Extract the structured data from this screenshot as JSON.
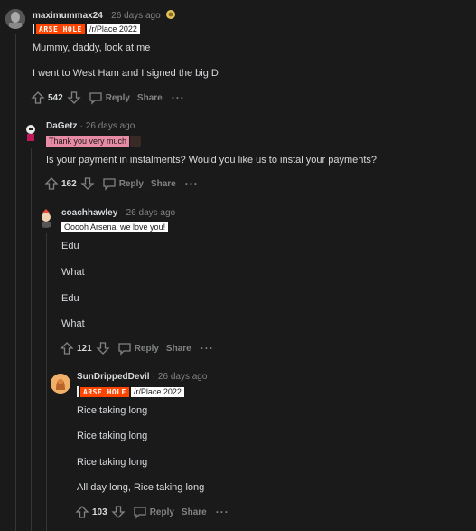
{
  "comments": [
    {
      "author": "maximummax24",
      "time": "26 days ago",
      "award": "award-icon",
      "flair": {
        "logo": "ARSE HOLE",
        "sub": "/r/Place 2022"
      },
      "lines": [
        "Mummy, daddy, look at me",
        "I went to West Ham and I signed the big D"
      ],
      "score": "542",
      "reply": "Reply",
      "share": "Share",
      "more": "···"
    },
    {
      "author": "DaGetz",
      "time": "26 days ago",
      "flair": {
        "text": "Thank you very much"
      },
      "lines": [
        "Is your payment in instalments? Would you like us to instal your payments?"
      ],
      "score": "162",
      "reply": "Reply",
      "share": "Share",
      "more": "···"
    },
    {
      "author": "coachhawley",
      "time": "26 days ago",
      "flair": {
        "text": "Ooooh Arsenal we love you!"
      },
      "lines": [
        "Edu",
        "What",
        "Edu",
        "What"
      ],
      "score": "121",
      "reply": "Reply",
      "share": "Share",
      "more": "···"
    },
    {
      "author": "SunDrippedDevil",
      "time": "26 days ago",
      "flair": {
        "logo": "ARSE HOLE",
        "sub": "/r/Place 2022"
      },
      "lines": [
        "Rice taking long",
        "Rice taking long",
        "Rice taking long",
        "All day long, Rice taking long"
      ],
      "score": "103",
      "reply": "Reply",
      "share": "Share",
      "more": "···"
    }
  ],
  "sep": "·"
}
